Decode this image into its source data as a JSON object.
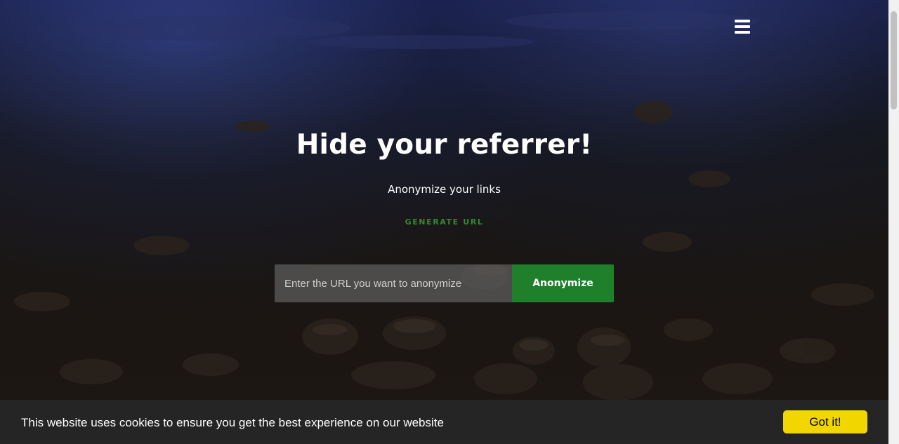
{
  "hero": {
    "title": "Hide your referrer!",
    "subtitle": "Anonymize your links",
    "generate_link": "GENERATE URL"
  },
  "form": {
    "url_placeholder": "Enter the URL you want to anonymize",
    "url_value": "",
    "submit_label": "Anonymize"
  },
  "cookie_banner": {
    "message": "This website uses cookies to ensure you get the best experience on our website",
    "accept_label": "Got it!"
  },
  "icons": {
    "menu": "hamburger-menu-icon"
  },
  "colors": {
    "accent_green": "#1f7f2a",
    "link_green": "#2f8c2f",
    "cookie_button": "#f1d600",
    "cookie_bar": "#252525"
  }
}
